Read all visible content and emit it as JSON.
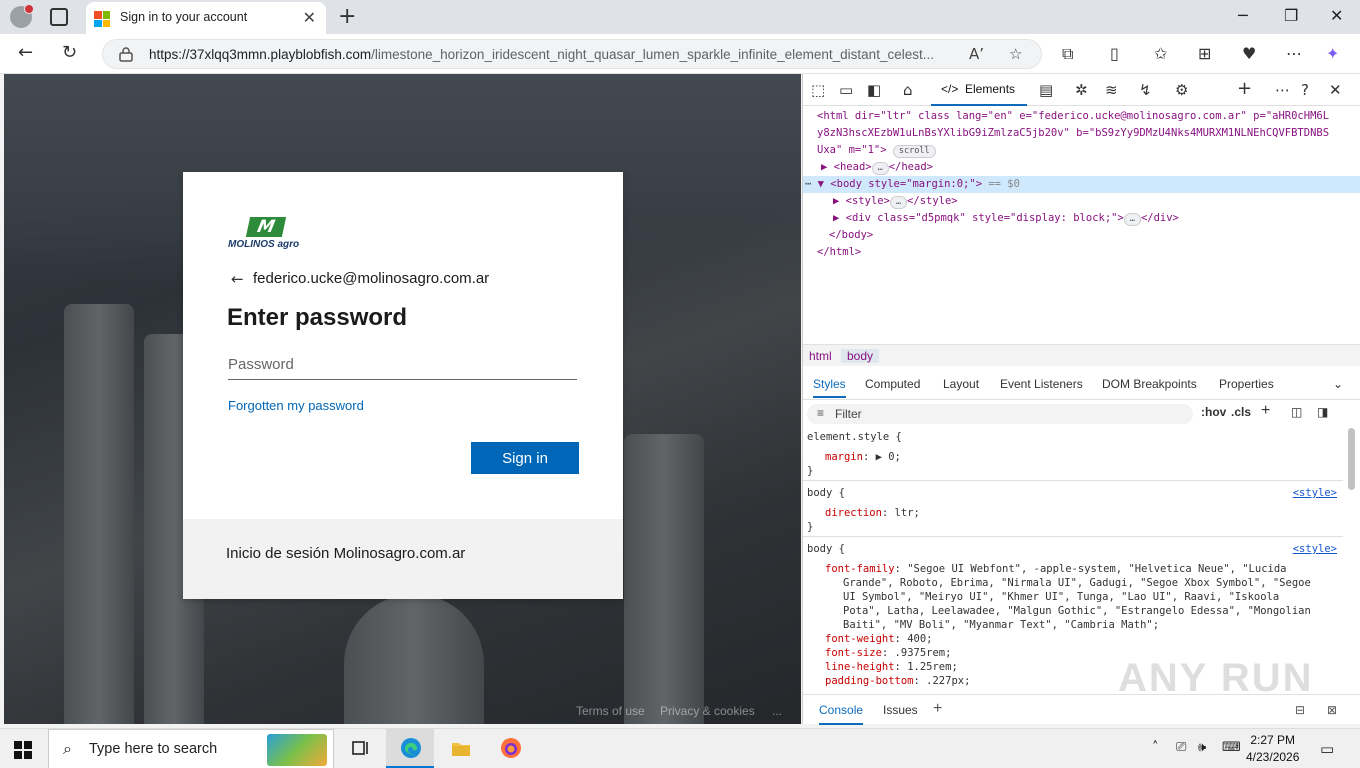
{
  "browser": {
    "tab_title": "Sign in to your account",
    "new_tab_glyph": "+",
    "url_host": "https://37xlqq3mmn.playblobfish.com",
    "url_path": "/limestone_horizon_iridescent_night_quasar_lumen_sparkle_infinite_element_distant_celest...",
    "read_aloud_glyph": "A’"
  },
  "login": {
    "brand": "MOLINOS agro",
    "brand_mark": "M",
    "identity": "federico.ucke@molinosagro.com.ar",
    "heading": "Enter password",
    "password_placeholder": "Password",
    "forgot_link": "Forgotten my password",
    "signin_button": "Sign in",
    "footer_text": "Inicio de sesión Molinosagro.com.ar"
  },
  "page_footer": {
    "terms": "Terms of use",
    "privacy": "Privacy & cookies",
    "more": "..."
  },
  "devtools": {
    "elements_tab": "Elements",
    "dom": {
      "html_open_1": "<html dir=\"ltr\" class lang=\"en\" e=\"federico.ucke@molinosagro.com.ar\" p=\"aHR0cHM6L",
      "html_open_2": "y8zN3hscXEzbW1uLnBsYXlibG9iZmlzaC5jb20v\" b=\"bS9zYy9DMzU4Nks4MURXM1NLNEhCQVFBTDNBS",
      "html_open_3": "Uxa\" m=\"1\">",
      "scroll_pill": "scroll",
      "head": "<head>",
      "head_close": "</head>",
      "body_open": "<body style=\"margin:0;\">",
      "body_marker": "== $0",
      "style_open": "<style>",
      "style_close": "</style>",
      "div_open": "<div class=\"d5pmqk\" style=\"display: block;\">",
      "div_close": "</div>",
      "body_close": "</body>",
      "html_close": "</html>",
      "ellipsis": "…"
    },
    "breadcrumb": [
      "html",
      "body"
    ],
    "subtabs": [
      "Styles",
      "Computed",
      "Layout",
      "Event Listeners",
      "DOM Breakpoints",
      "Properties"
    ],
    "filter_placeholder": "Filter",
    "hov": ":hov",
    "cls": ".cls",
    "styles": {
      "r1_selector": "element.style {",
      "r1_prop": "margin",
      "r1_val": ": ▶ 0;",
      "r2_selector": "body {",
      "r2_src": "<style>",
      "r2_prop": "direction",
      "r2_val": ": ltr;",
      "r3_selector": "body {",
      "r3_src": "<style>",
      "ff_prop": "font-family",
      "ff_1": ": \"Segoe UI Webfont\", -apple-system, \"Helvetica Neue\", \"Lucida",
      "ff_2": "Grande\", Roboto, Ebrima, \"Nirmala UI\", Gadugi, \"Segoe Xbox Symbol\", \"Segoe",
      "ff_3": "UI Symbol\", \"Meiryo UI\", \"Khmer UI\", Tunga, \"Lao UI\", Raavi, \"Iskoola",
      "ff_4": "Pota\", Latha, Leelawadee, \"Malgun Gothic\", \"Estrangelo Edessa\", \"Mongolian",
      "ff_5": "Baiti\", \"MV Boli\", \"Myanmar Text\", \"Cambria Math\";",
      "fw_prop": "font-weight",
      "fw_val": ": 400;",
      "fs_prop": "font-size",
      "fs_val": ": .9375rem;",
      "lh_prop": "line-height",
      "lh_val": ": 1.25rem;",
      "pb_prop": "padding-bottom",
      "pb_val": ": .227px;",
      "close": "}"
    },
    "drawer_tabs": [
      "Console",
      "Issues"
    ],
    "drawer_add": "+"
  },
  "watermark": "ANY RUN",
  "taskbar": {
    "search_placeholder": "Type here to search",
    "time": "2:27 PM",
    "date": "4/23/2026"
  },
  "colors": {
    "accent": "#0067b8",
    "brand_green": "#2e8b3a",
    "devtools_accent": "#0f6cbd"
  }
}
